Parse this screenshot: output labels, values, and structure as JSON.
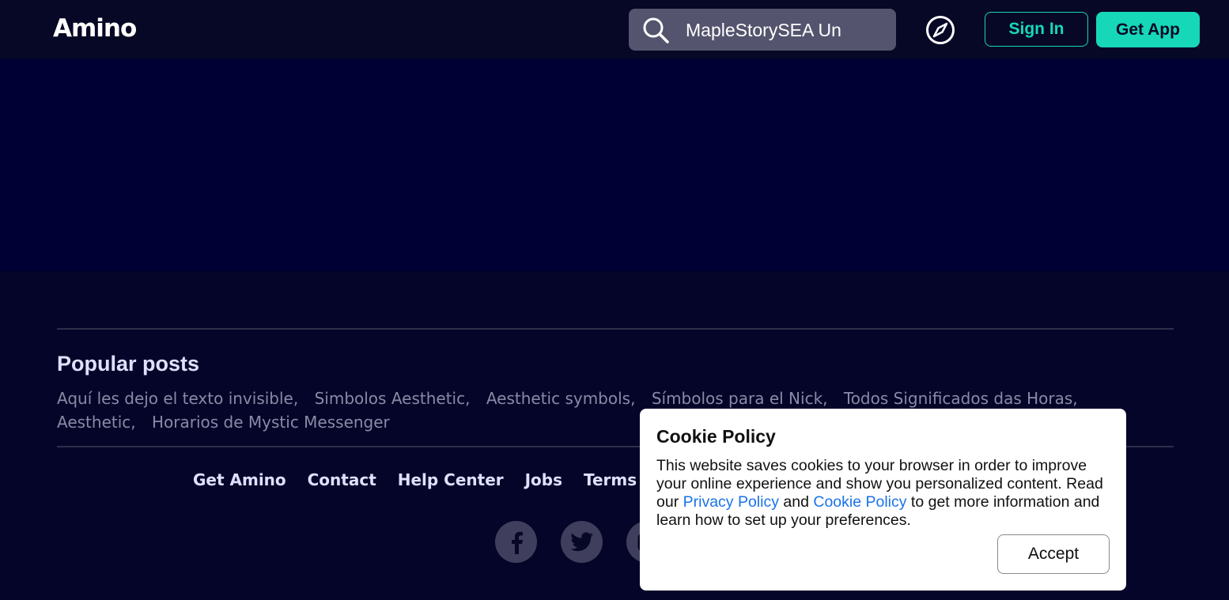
{
  "header": {
    "logo": "Amino",
    "search_value": "MapleStorySEA Un",
    "sign_in": "Sign In",
    "get_app": "Get App"
  },
  "popular": {
    "title": "Popular posts",
    "items": [
      "Aquí les dejo el texto invisible,",
      "Simbolos Aesthetic,",
      "Aesthetic symbols,",
      "Símbolos para el Nick,",
      "Todos Significados das Horas,",
      "Aesthetic,",
      "Horarios de Mystic Messenger"
    ]
  },
  "footer": {
    "links": [
      "Get Amino",
      "Contact",
      "Help Center",
      "Jobs",
      "Terms of"
    ],
    "social_icons": [
      "facebook-icon",
      "twitter-icon",
      "instagram-icon"
    ]
  },
  "cookie": {
    "title": "Cookie Policy",
    "text_before": "This website saves cookies to your browser in order to improve your online experience and show you personalized content. Read our ",
    "privacy_link": "Privacy Policy",
    "text_and": " and ",
    "cookie_link": "Cookie Policy",
    "text_after": " to get more information and learn how to set up your preferences.",
    "accept": "Accept"
  },
  "colors": {
    "accent": "#16d8b8",
    "header_bg": "#070726",
    "banner_bg": "#000035",
    "page_bg": "#05052a",
    "link_blue": "#1a73e8"
  }
}
